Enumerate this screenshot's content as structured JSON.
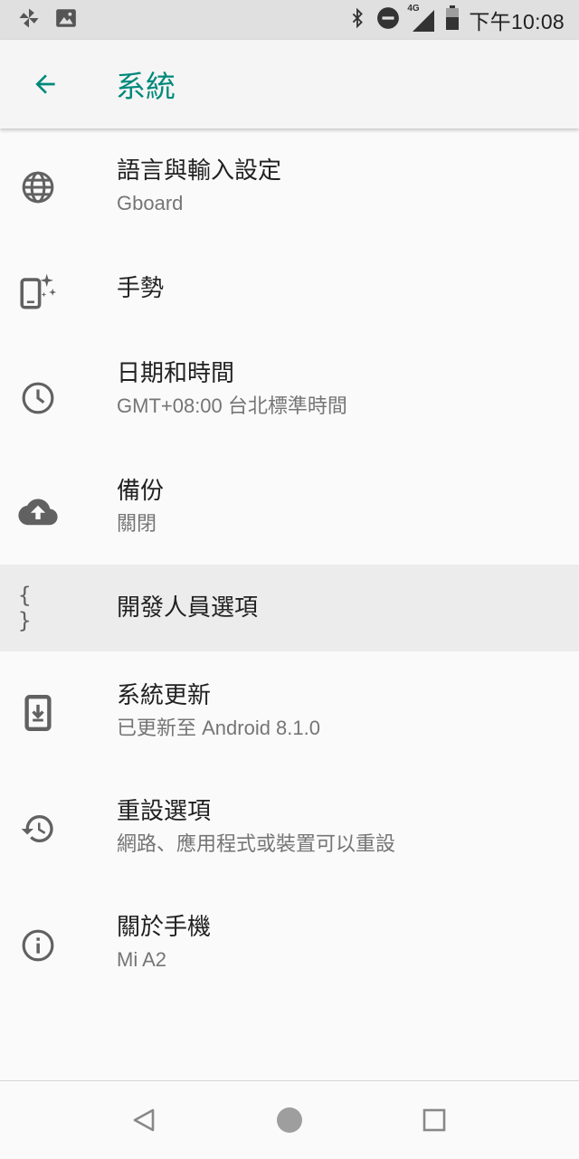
{
  "status_bar": {
    "left_icons": [
      "pinwheel-icon",
      "image-icon"
    ],
    "right_icons": [
      "bluetooth-icon",
      "do-not-disturb-icon",
      "signal-4g-icon",
      "battery-icon"
    ],
    "network_label": "4G",
    "time": "下午10:08"
  },
  "app_bar": {
    "back_icon": "arrow-back-icon",
    "title": "系統",
    "accent_color": "#00897b"
  },
  "settings": [
    {
      "icon": "globe-icon",
      "title": "語言與輸入設定",
      "summary": "Gboard"
    },
    {
      "icon": "gesture-phone-icon",
      "title": "手勢",
      "summary": ""
    },
    {
      "icon": "clock-icon",
      "title": "日期和時間",
      "summary": "GMT+08:00 台北標準時間"
    },
    {
      "icon": "cloud-upload-icon",
      "title": "備份",
      "summary": "關閉"
    },
    {
      "icon": "braces-icon",
      "icon_text": "{ }",
      "title": "開發人員選項",
      "summary": "",
      "highlighted": true
    },
    {
      "icon": "system-update-icon",
      "title": "系統更新",
      "summary": "已更新至 Android 8.1.0"
    },
    {
      "icon": "restore-icon",
      "title": "重設選項",
      "summary": "網路、應用程式或裝置可以重設"
    },
    {
      "icon": "info-icon",
      "title": "關於手機",
      "summary": "Mi A2"
    }
  ],
  "nav_bar": {
    "buttons": [
      "back-triangle-icon",
      "home-circle-icon",
      "recents-square-icon"
    ]
  }
}
